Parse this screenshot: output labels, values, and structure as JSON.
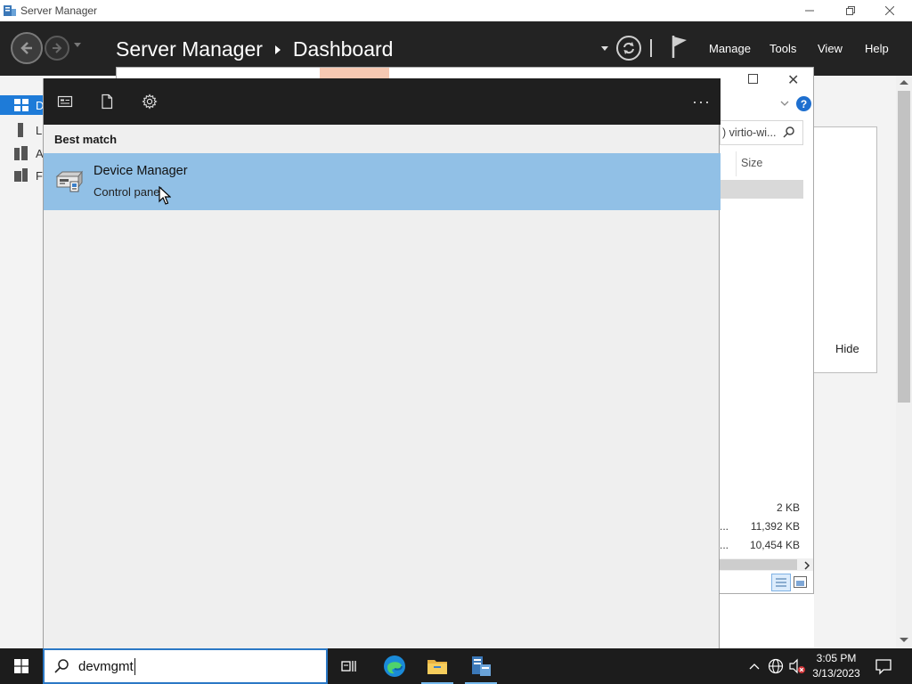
{
  "window": {
    "title": "Server Manager"
  },
  "header": {
    "app_name": "Server Manager",
    "page": "Dashboard",
    "menu": [
      "Manage",
      "Tools",
      "View",
      "Help"
    ]
  },
  "left_nav": {
    "letters": [
      "D",
      "L",
      "A",
      "F"
    ]
  },
  "background_explorer": {
    "search_text": ") virtio-wi...",
    "column_size": "Size",
    "sizes": [
      "2 KB",
      "11,392 KB",
      "10,454 KB"
    ],
    "dots": [
      "...",
      "..."
    ],
    "help_symbol": "?",
    "close_symbol": "✕"
  },
  "background_panel": {
    "hide_label": "Hide"
  },
  "search_panel": {
    "best_match_label": "Best match",
    "result": {
      "title": "Device Manager",
      "subtitle": "Control panel"
    },
    "more_symbol": "···"
  },
  "taskbar": {
    "search_query": "devmgmt",
    "clock_time": "3:05 PM",
    "clock_date": "3/13/2023"
  },
  "colors": {
    "header_bg": "#232323",
    "result_highlight": "#91c0e6",
    "taskbar_bg": "#1c1c1c",
    "accent": "#1e7bd8"
  }
}
